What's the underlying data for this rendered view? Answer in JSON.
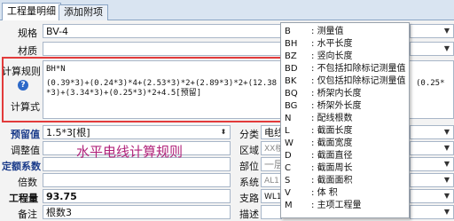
{
  "tabs": [
    {
      "label": "工程量明细"
    },
    {
      "label": "添加附项"
    }
  ],
  "form": {
    "spec_label": "规格",
    "spec_value": "BV-4",
    "material_label": "材质",
    "rule_label": "计算规则",
    "rule_value": "BH*N",
    "formula_label": "计算式",
    "formula_text": "(0.39*3)+(0.24*3)*4+(2.53*3)*2+(2.89*3)*2+(12.38*3)+(3.34*3)+(0.25*3)*2+4.5[预留]",
    "formula_right": "(0.25*",
    "reserve_label": "预留值",
    "reserve_value": "1.5*3[根]",
    "adjust_label": "调整值",
    "quota_label": "定额系数",
    "multiple_label": "倍数",
    "quantity_label": "工程量",
    "quantity_value": "93.75",
    "remark_label": "备注",
    "remark_value": "根数3"
  },
  "right_fields": {
    "category_label": "分类",
    "category_value": "电线",
    "region_label": "区域",
    "region_value": "XX楼",
    "part_label": "部位",
    "part_value": "一层",
    "system_label": "系统",
    "system_value": "AL1",
    "branch_label": "支路",
    "branch_value": "WL1",
    "desc_label": "描述"
  },
  "overlay_annotation": "水平电线计算规则",
  "menu_items": [
    {
      "code": "B",
      "desc": "测量值"
    },
    {
      "code": "BH",
      "desc": "水平长度"
    },
    {
      "code": "BZ",
      "desc": "竖向长度"
    },
    {
      "code": "BD",
      "desc": "不包括扣除标记测量值"
    },
    {
      "code": "BK",
      "desc": "仅包括扣除标记测量值"
    },
    {
      "code": "BQ",
      "desc": "桥架内长度"
    },
    {
      "code": "BG",
      "desc": "桥架外长度"
    },
    {
      "code": "N",
      "desc": "配线根数"
    },
    {
      "code": "L",
      "desc": "截面长度"
    },
    {
      "code": "W",
      "desc": "截面宽度"
    },
    {
      "code": "D",
      "desc": "截面直径"
    },
    {
      "code": "C",
      "desc": "截面周长"
    },
    {
      "code": "S",
      "desc": "截面面积"
    },
    {
      "code": "V",
      "desc": "体  积"
    },
    {
      "code": "M",
      "desc": "主项工程量"
    }
  ],
  "colors": {
    "highlight_border": "#e23b3b",
    "annotation_text": "#b0227a",
    "label_blue": "#1a3b8a"
  }
}
